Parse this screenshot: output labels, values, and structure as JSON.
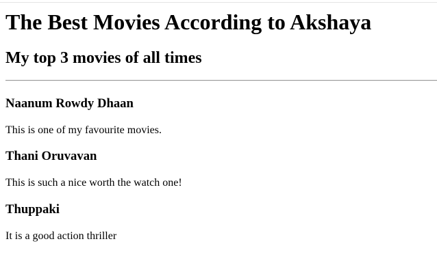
{
  "page": {
    "title": "The Best Movies According to Akshaya",
    "subtitle": "My top 3 movies of all times"
  },
  "movies": [
    {
      "title": "Naanum Rowdy Dhaan",
      "description": "This is one of my favourite movies."
    },
    {
      "title": "Thani Oruvavan",
      "description": "This is such a nice worth the watch one!"
    },
    {
      "title": "Thuppaki",
      "description": "It is a good action thriller"
    }
  ]
}
